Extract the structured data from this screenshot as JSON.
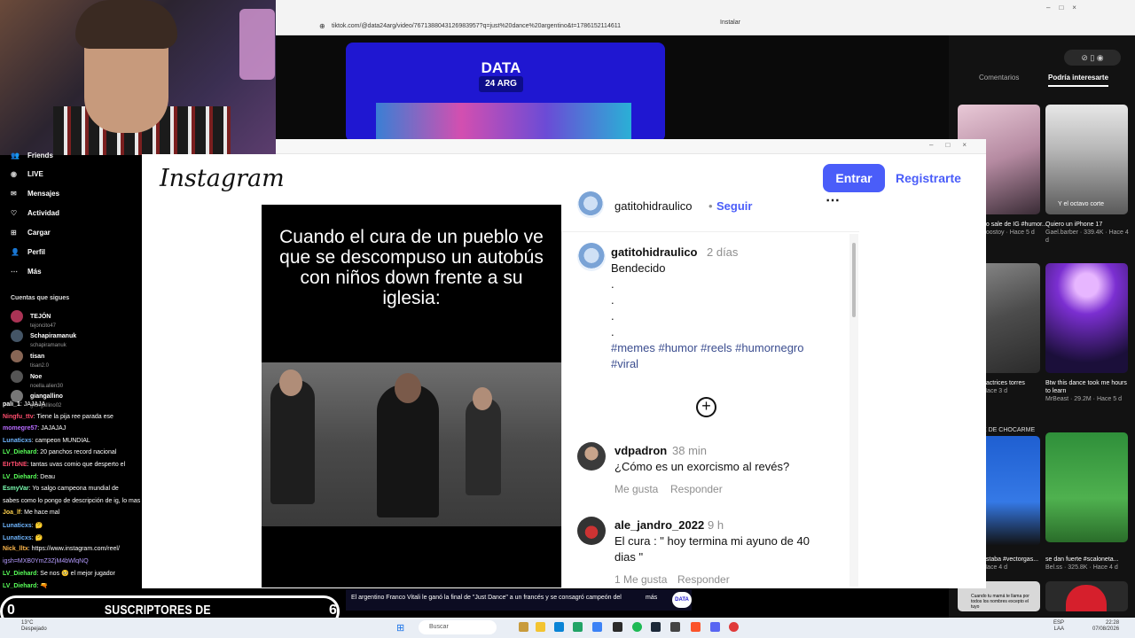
{
  "browser": {
    "url": "tiktok.com/@data24arg/video/7671388043126983957?q=just%20dance%20argentino&t=1786152114611",
    "install_label": "Instalar"
  },
  "tiktok": {
    "banner_logo": "DATA",
    "banner_sub": "24 ARG",
    "tabs": {
      "comments": "Comentarios",
      "interest": "Podría interesarte"
    },
    "cards": [
      {
        "caption": "no sale de IG #humor...",
        "meta": "noostoy · Hace 5 d"
      },
      {
        "caption": "Quiero un iPhone 17",
        "meta": "Gael.barber · 339.4K · Hace 4 d",
        "overlay": "Y el octavo corte"
      },
      {
        "caption": ": actrices torres",
        "meta": "Hace 3 d"
      },
      {
        "caption": "Btw this dance took me hours to learn",
        "meta": "MrBeast · 29.2M · Hace 5 d"
      },
      {
        "caption": "estaba #vectorgas...",
        "meta": "Hace 4 d"
      },
      {
        "caption": "se dan fuerte #scaloneta...",
        "meta": "Bel.ss · 325.8K · Hace 4 d"
      },
      {
        "caption": "Cuando tu mamá te llama por todos los nombres excepto el tuyo",
        "meta": ""
      }
    ],
    "label_chocarme": "E DE CHOCARME"
  },
  "sidebar": {
    "items": [
      {
        "icon": "friends-icon",
        "label": "Friends"
      },
      {
        "icon": "live-icon",
        "label": "LIVE"
      },
      {
        "icon": "messages-icon",
        "label": "Mensajes"
      },
      {
        "icon": "activity-icon",
        "label": "Actividad"
      },
      {
        "icon": "upload-icon",
        "label": "Cargar"
      },
      {
        "icon": "profile-icon",
        "label": "Perfil"
      },
      {
        "icon": "more-icon",
        "label": "Más"
      }
    ],
    "following_title": "Cuentas que sigues",
    "following": [
      {
        "name": "TEJÓN",
        "handle": "tejoncito47"
      },
      {
        "name": "Schapiramanuk",
        "handle": "schapiramanuk"
      },
      {
        "name": "tisan",
        "handle": "tisan2.0"
      },
      {
        "name": "Noe",
        "handle": "noella.alien30"
      },
      {
        "name": "giangallino",
        "handle": "giangallino02"
      }
    ]
  },
  "chat": [
    {
      "user": "pali_1",
      "text": ": JAJAJA",
      "color": "#ffffff"
    },
    {
      "user": "Ningfu_ttv",
      "text": ": Tiene la pija ree parada ese",
      "color": "#ff4d6d"
    },
    {
      "user": "momegre57",
      "text": ": JAJAJAJ",
      "color": "#b76bff"
    },
    {
      "user": "Lunaticxs",
      "text": ": campeon MUNDIAL",
      "color": "#6fb6ff"
    },
    {
      "user": "LV_Diehard",
      "text": ": 20 panchos record nacional",
      "color": "#59ff59"
    },
    {
      "user": "EIrTbNE",
      "text": ": tantas uvas comio que desperto el",
      "color": "#ff4d6d"
    },
    {
      "user": "LV_Diehard",
      "text": ": Deau",
      "color": "#59ff59"
    },
    {
      "user": "EsmyVar",
      "text": ": Yo salgo campeona mundial de",
      "color": "#7cffb2"
    },
    {
      "user": "",
      "text": "sabes como lo pongo de descripción de ig, lo mas lindo",
      "color": "#ffffff"
    },
    {
      "user": "Joa_lf",
      "text": ": Me hace mal",
      "color": "#ffd24d"
    },
    {
      "user": "Lunaticxs",
      "text": ": 🤔",
      "color": "#6fb6ff"
    },
    {
      "user": "Lunaticxs",
      "text": ": 🤔",
      "color": "#6fb6ff"
    },
    {
      "user": "Nick_lltx",
      "text": ": https://www.instagram.com/reel/",
      "color": "#ffb84d"
    },
    {
      "user": "",
      "text": "igsh=MXB0YmZ3ZjM4bWlqNQ",
      "color": "#b59cff"
    },
    {
      "user": "LV_Diehard",
      "text": ": Se nos 🥺 el mejor jugador",
      "color": "#59ff59"
    },
    {
      "user": "LV_Diehard",
      "text": ": 🔫",
      "color": "#59ff59"
    }
  ],
  "instagram": {
    "logo": "Instagram",
    "login_label": "Entrar",
    "signup_label": "Registrarte",
    "reel_caption": "Cuando el cura de un pueblo ve que se descompuso un autobús con niños down frente a su iglesia:",
    "post": {
      "username": "gatitohidraulico",
      "follow_label": "Seguir",
      "more_icon": "more-horizontal-icon",
      "caption_user": "gatitohidraulico",
      "caption_time": "2 días",
      "caption_text": "Bendecido",
      "dots": [
        ".",
        ".",
        ".",
        "."
      ],
      "hashtags_line1": "#memes #humor #reels #humornegro",
      "hashtags_line2": "#viral"
    },
    "comments": [
      {
        "user": "vdpadron",
        "time": "38 min",
        "text": "¿Cómo es un exorcismo al revés?",
        "like": "Me gusta",
        "reply": "Responder"
      },
      {
        "user": "ale_jandro_2022",
        "time": "9 h",
        "text_line1": "El cura : \" hoy termina mi ayuno de 40",
        "text_line2": "dias \"",
        "like": "1 Me gusta",
        "reply": "Responder"
      }
    ]
  },
  "overlay": {
    "subs_left": "0",
    "subs_title": "SUSCRIPTORES DE HOY",
    "subs_right": "6",
    "news": "El argentino Franco Vitali le ganó la final de \"Just Dance\" a un francés y se consagró campeón del",
    "news_more": "más",
    "news_logo": "DATA"
  },
  "taskbar": {
    "weather_temp": "13°C",
    "weather_desc": "Despejado",
    "search_placeholder": "Buscar",
    "lang1": "ESP",
    "lang2": "LAA",
    "time": "22:28",
    "date": "07/08/2026"
  }
}
